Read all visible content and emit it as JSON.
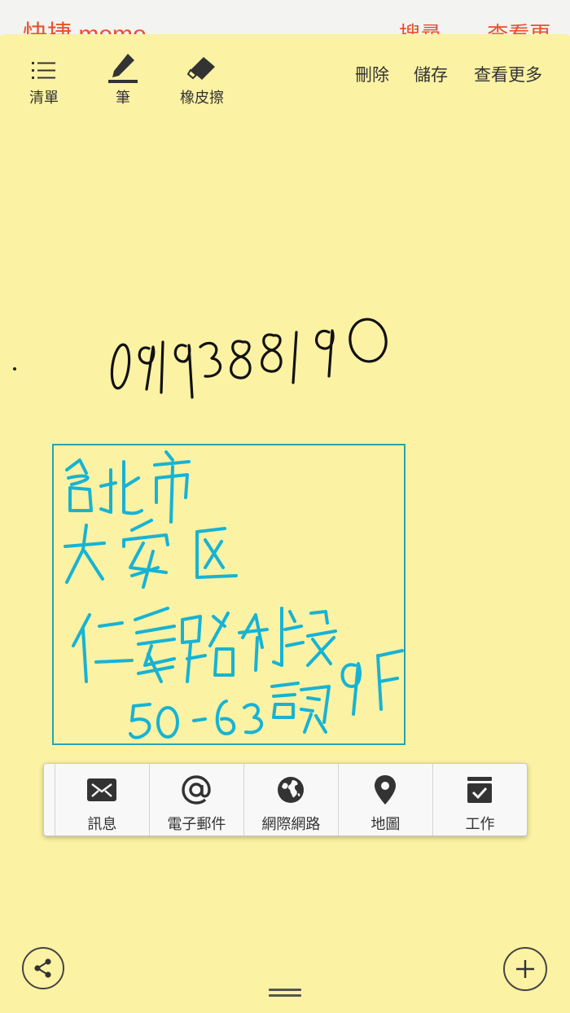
{
  "background_app": {
    "title": "快捷 memo",
    "actions": [
      "搜尋",
      "查看更多"
    ]
  },
  "toolbar": {
    "list_label": "清單",
    "pen_label": "筆",
    "eraser_label": "橡皮擦",
    "delete_label": "刪除",
    "save_label": "儲存",
    "more_label": "查看更多"
  },
  "handwriting": {
    "number": "0919388190",
    "address_lines": [
      "台北市",
      "大安区",
      "仁愛路4段",
      "50-63號9F"
    ]
  },
  "context_menu": {
    "items": [
      {
        "label": "訊息",
        "icon": "message-icon"
      },
      {
        "label": "電子郵件",
        "icon": "email-icon"
      },
      {
        "label": "網際網路",
        "icon": "globe-icon"
      },
      {
        "label": "地圖",
        "icon": "map-pin-icon"
      },
      {
        "label": "工作",
        "icon": "task-icon"
      }
    ]
  },
  "colors": {
    "paper": "#fbf2a3",
    "selection": "#2aa2b0",
    "address_ink": "#1db6d6",
    "accent": "#e8502b"
  }
}
